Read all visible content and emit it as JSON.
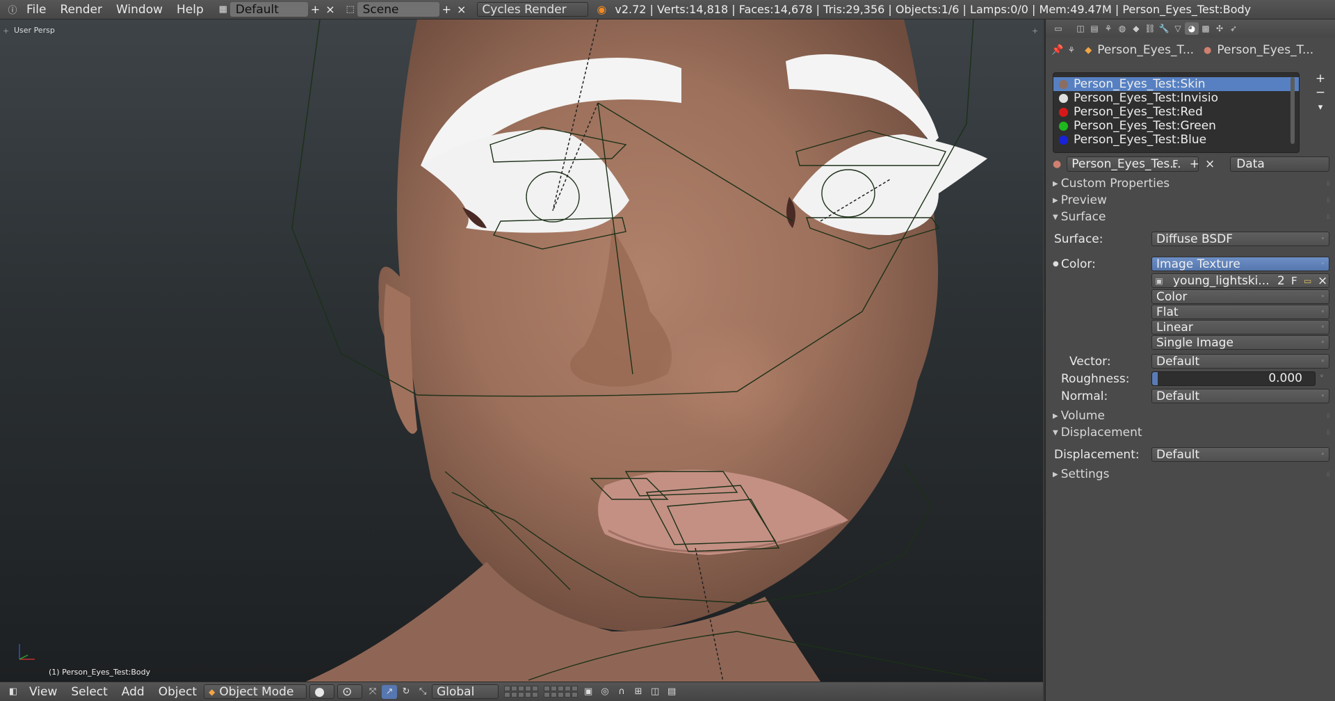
{
  "topbar": {
    "menus": [
      "File",
      "Render",
      "Window",
      "Help"
    ],
    "screen_layout": "Default",
    "scene": "Scene",
    "render_engine": "Cycles Render",
    "stats": "v2.72 | Verts:14,818 | Faces:14,678 | Tris:29,356 | Objects:1/6 | Lamps:0/0 | Mem:49.47M | Person_Eyes_Test:Body",
    "add": "+",
    "remove": "×"
  },
  "viewport": {
    "view_label": "User Persp",
    "object_label": "(1) Person_Eyes_Test:Body"
  },
  "bottombar": {
    "menus": [
      "View",
      "Select",
      "Add",
      "Object"
    ],
    "mode": "Object Mode",
    "orientation": "Global"
  },
  "properties": {
    "context": {
      "object": "Person_Eyes_T...",
      "material": "Person_Eyes_T..."
    },
    "material_slots": [
      {
        "name": "Person_Eyes_Test:Skin",
        "color": "#8a6e62",
        "selected": true
      },
      {
        "name": "Person_Eyes_Test:Invisio",
        "color": "#e0e0e0",
        "selected": false
      },
      {
        "name": "Person_Eyes_Test:Red",
        "color": "#d81818",
        "selected": false
      },
      {
        "name": "Person_Eyes_Test:Green",
        "color": "#1eb81e",
        "selected": false
      },
      {
        "name": "Person_Eyes_Test:Blue",
        "color": "#1822d8",
        "selected": false
      }
    ],
    "slot_add": "+",
    "slot_remove": "−",
    "slot_menu": "▾",
    "material_field": "Person_Eyes_Tes...",
    "fake_user": "F",
    "add": "+",
    "remove": "×",
    "data_link": "Data",
    "sections": {
      "custom_properties": "Custom Properties",
      "preview": "Preview",
      "surface": "Surface",
      "volume": "Volume",
      "displacement": "Displacement",
      "settings": "Settings"
    },
    "surface": {
      "surface_label": "Surface:",
      "surface_value": "Diffuse BSDF",
      "color_label": "Color:",
      "color_value": "Image Texture",
      "image_name": "young_lightski...",
      "image_users": "2",
      "image_fake": "F",
      "color_space": "Color",
      "projection": "Flat",
      "interpolation": "Linear",
      "source": "Single Image",
      "vector_label": "Vector:",
      "vector_value": "Default",
      "roughness_label": "Roughness:",
      "roughness_value": "0.000",
      "normal_label": "Normal:",
      "normal_value": "Default"
    },
    "displacement": {
      "label": "Displacement:",
      "value": "Default"
    }
  }
}
